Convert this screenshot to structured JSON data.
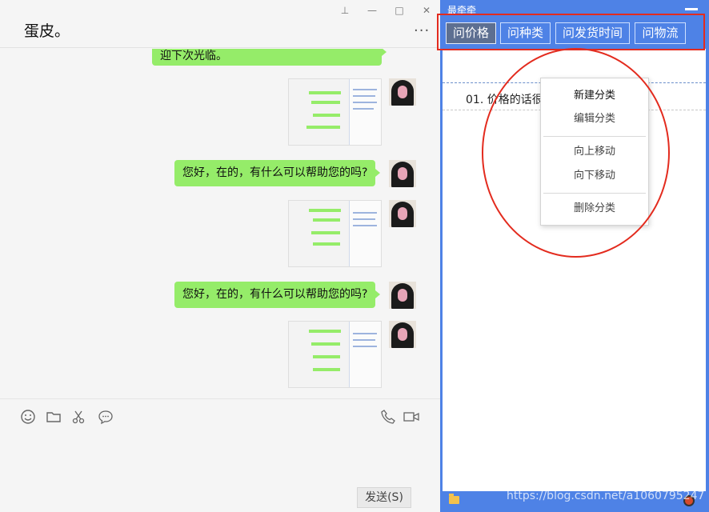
{
  "chat": {
    "title": "蛋皮。",
    "window_controls": {
      "pin": "⊥",
      "minimize": "—",
      "maximize": "□",
      "close": "✕"
    },
    "more": "···",
    "messages": [
      {
        "type": "text",
        "text": "迎下次光临。",
        "partial": true
      },
      {
        "type": "image"
      },
      {
        "type": "text",
        "text": "您好，在的，有什么可以帮助您的吗?"
      },
      {
        "type": "image"
      },
      {
        "type": "text",
        "text": "您好，在的，有什么可以帮助您的吗?"
      },
      {
        "type": "image"
      }
    ],
    "toolbar_icons": [
      "emoji-icon",
      "folder-icon",
      "scissors-icon",
      "chat-history-icon",
      "phone-icon",
      "video-call-icon"
    ],
    "send_label": "发送(S)"
  },
  "panel": {
    "title": "最牵牵",
    "tabs": [
      {
        "label": "问价格",
        "active": true
      },
      {
        "label": "问种类",
        "active": false
      },
      {
        "label": "问发货时间",
        "active": false
      },
      {
        "label": "问物流",
        "active": false
      }
    ],
    "phrase": "01. 价格的话很实惠，欢迎购买亲亲!",
    "context_menu": {
      "items": [
        {
          "label": "新建分类",
          "bold": true
        },
        {
          "label": "编辑分类",
          "bold": false
        },
        {
          "label": "向上移动",
          "bold": false
        },
        {
          "label": "向下移动",
          "bold": false
        },
        {
          "label": "删除分类",
          "bold": false
        }
      ]
    }
  },
  "watermark": "https://blog.csdn.net/a1060795247",
  "colors": {
    "bubble_green": "#95ec69",
    "panel_blue": "#4e82e6",
    "active_tab": "#5d6f91",
    "annotation_red": "#e32b1e"
  }
}
